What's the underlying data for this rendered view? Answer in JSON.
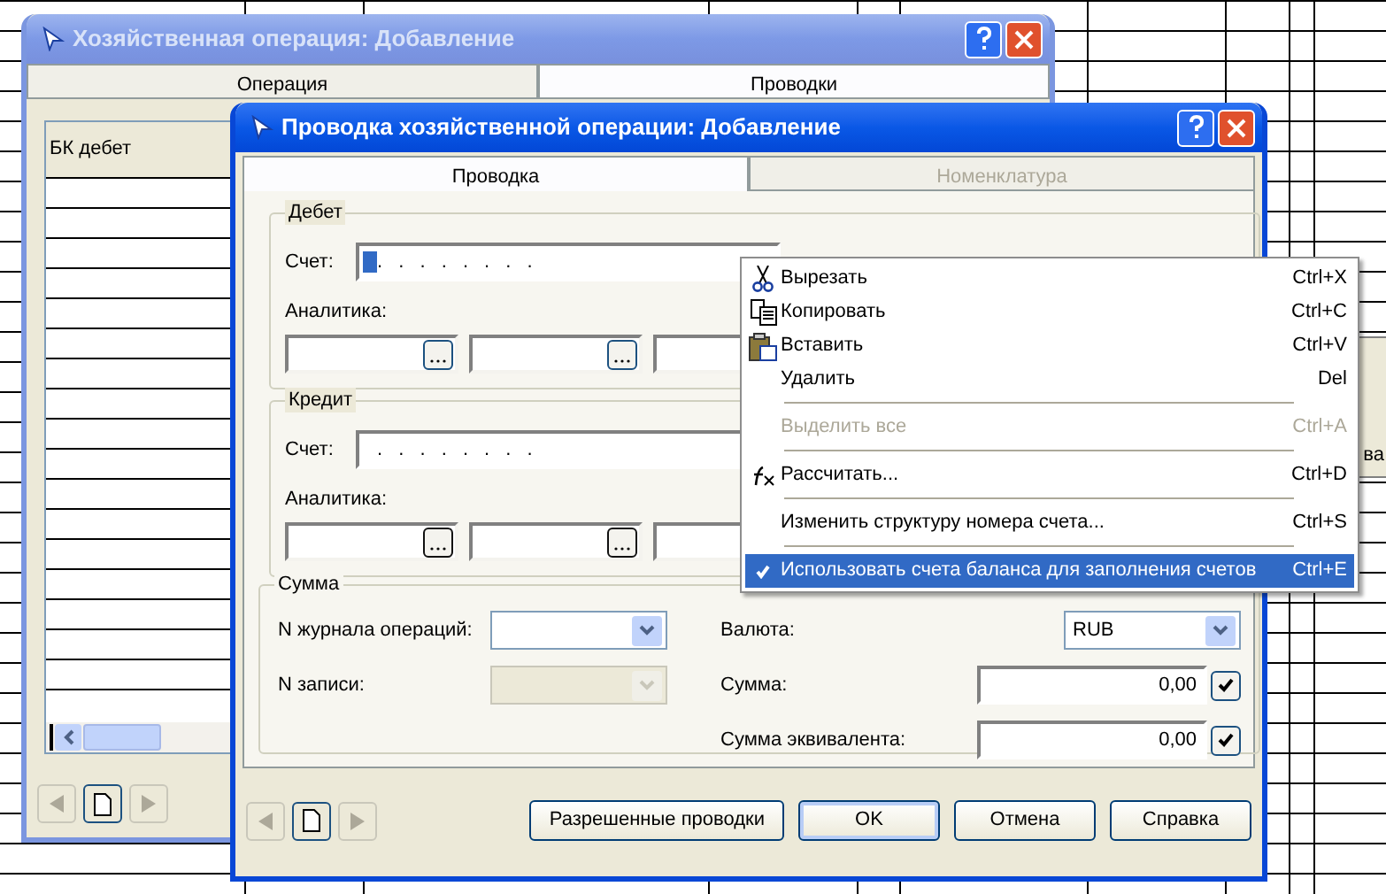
{
  "back_window": {
    "title": "Хозяйственная операция: Добавление",
    "active": false,
    "tabs": [
      {
        "label": "Операция",
        "selected": false
      },
      {
        "label": "Проводки",
        "selected": true
      }
    ],
    "table": {
      "columns": [
        "БК дебет"
      ]
    }
  },
  "background_fragment": "ва",
  "dialog": {
    "title": "Проводка хозяйственной операции: Добавление",
    "active": true,
    "tabs": [
      {
        "label": "Проводка",
        "selected": true,
        "disabled": false
      },
      {
        "label": "Номенклатура",
        "selected": false,
        "disabled": true
      }
    ],
    "debit": {
      "legend": "Дебет",
      "account_label": "Счет:",
      "account_mask": ". . . . . . . .",
      "focused": true,
      "analytics_label": "Аналитика:"
    },
    "credit": {
      "legend": "Кредит",
      "account_label": "Счет:",
      "account_mask": ". . . . . . . .",
      "focused": false,
      "analytics_label": "Аналитика:"
    },
    "sum": {
      "legend": "Сумма",
      "journal": {
        "label": "N журнала операций:",
        "disabled": false
      },
      "record": {
        "label": "N записи:",
        "disabled": true
      },
      "currency": {
        "label": "Валюта:",
        "value": "RUB"
      },
      "amount": {
        "label": "Сумма:",
        "value": "0,00",
        "checked": true
      },
      "equivalent": {
        "label": "Сумма эквивалента:",
        "value": "0,00",
        "checked": true
      }
    },
    "buttons": [
      {
        "label": "Разрешенные проводки",
        "default": false
      },
      {
        "label": "OK",
        "default": true
      },
      {
        "label": "Отмена",
        "default": false
      },
      {
        "label": "Справка",
        "default": false
      }
    ]
  },
  "context_menu": {
    "items": [
      {
        "kind": "item",
        "label": "Вырезать",
        "shortcut": "Ctrl+X",
        "disabled": false,
        "checked": false,
        "selected": false
      },
      {
        "kind": "item",
        "label": "Копировать",
        "shortcut": "Ctrl+C",
        "disabled": false,
        "checked": false,
        "selected": false
      },
      {
        "kind": "item",
        "label": "Вставить",
        "shortcut": "Ctrl+V",
        "disabled": false,
        "checked": false,
        "selected": false
      },
      {
        "kind": "item",
        "label": "Удалить",
        "shortcut": "Del",
        "disabled": false,
        "checked": false,
        "selected": false
      },
      {
        "kind": "separator"
      },
      {
        "kind": "item",
        "label": "Выделить все",
        "shortcut": "Ctrl+A",
        "disabled": true,
        "checked": false,
        "selected": false
      },
      {
        "kind": "separator"
      },
      {
        "kind": "item",
        "label": "Рассчитать...",
        "shortcut": "Ctrl+D",
        "disabled": false,
        "checked": false,
        "selected": false
      },
      {
        "kind": "separator"
      },
      {
        "kind": "item",
        "label": "Изменить структуру номера счета...",
        "shortcut": "Ctrl+S",
        "disabled": false,
        "checked": false,
        "selected": false
      },
      {
        "kind": "separator"
      },
      {
        "kind": "item",
        "label": "Использовать счета баланса для заполнения счетов",
        "shortcut": "Ctrl+E",
        "disabled": false,
        "checked": true,
        "selected": true
      }
    ]
  }
}
